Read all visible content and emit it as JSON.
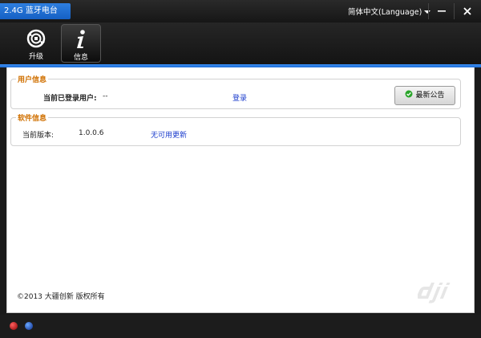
{
  "window": {
    "title": "2.4G 蓝牙电台",
    "language": "简体中文(Language)",
    "minimize_icon": "minimize-icon",
    "close_icon": "close-icon"
  },
  "toolbar": {
    "items": [
      {
        "label": "升级",
        "icon": "refresh-upgrade-icon",
        "active": false
      },
      {
        "label": "信息",
        "icon": "info-icon",
        "active": true
      }
    ]
  },
  "user_info": {
    "group_title": "用户信息",
    "current_user_label": "当前已登录用户:",
    "current_user_value": "--",
    "login_link": "登录",
    "notice_button": "最新公告"
  },
  "software_info": {
    "group_title": "软件信息",
    "version_label": "当前版本:",
    "version_value": "1.0.0.6",
    "update_link": "无可用更新"
  },
  "footer": {
    "copyright": "©2013 大疆创新 版权所有"
  },
  "status_lights": [
    {
      "name": "red-status-light",
      "color": "#d40000"
    },
    {
      "name": "blue-status-light",
      "color": "#1a4fd0"
    }
  ],
  "colors": {
    "accent": "#2070da",
    "group_title": "#d07000",
    "link": "#1a3bcc"
  }
}
